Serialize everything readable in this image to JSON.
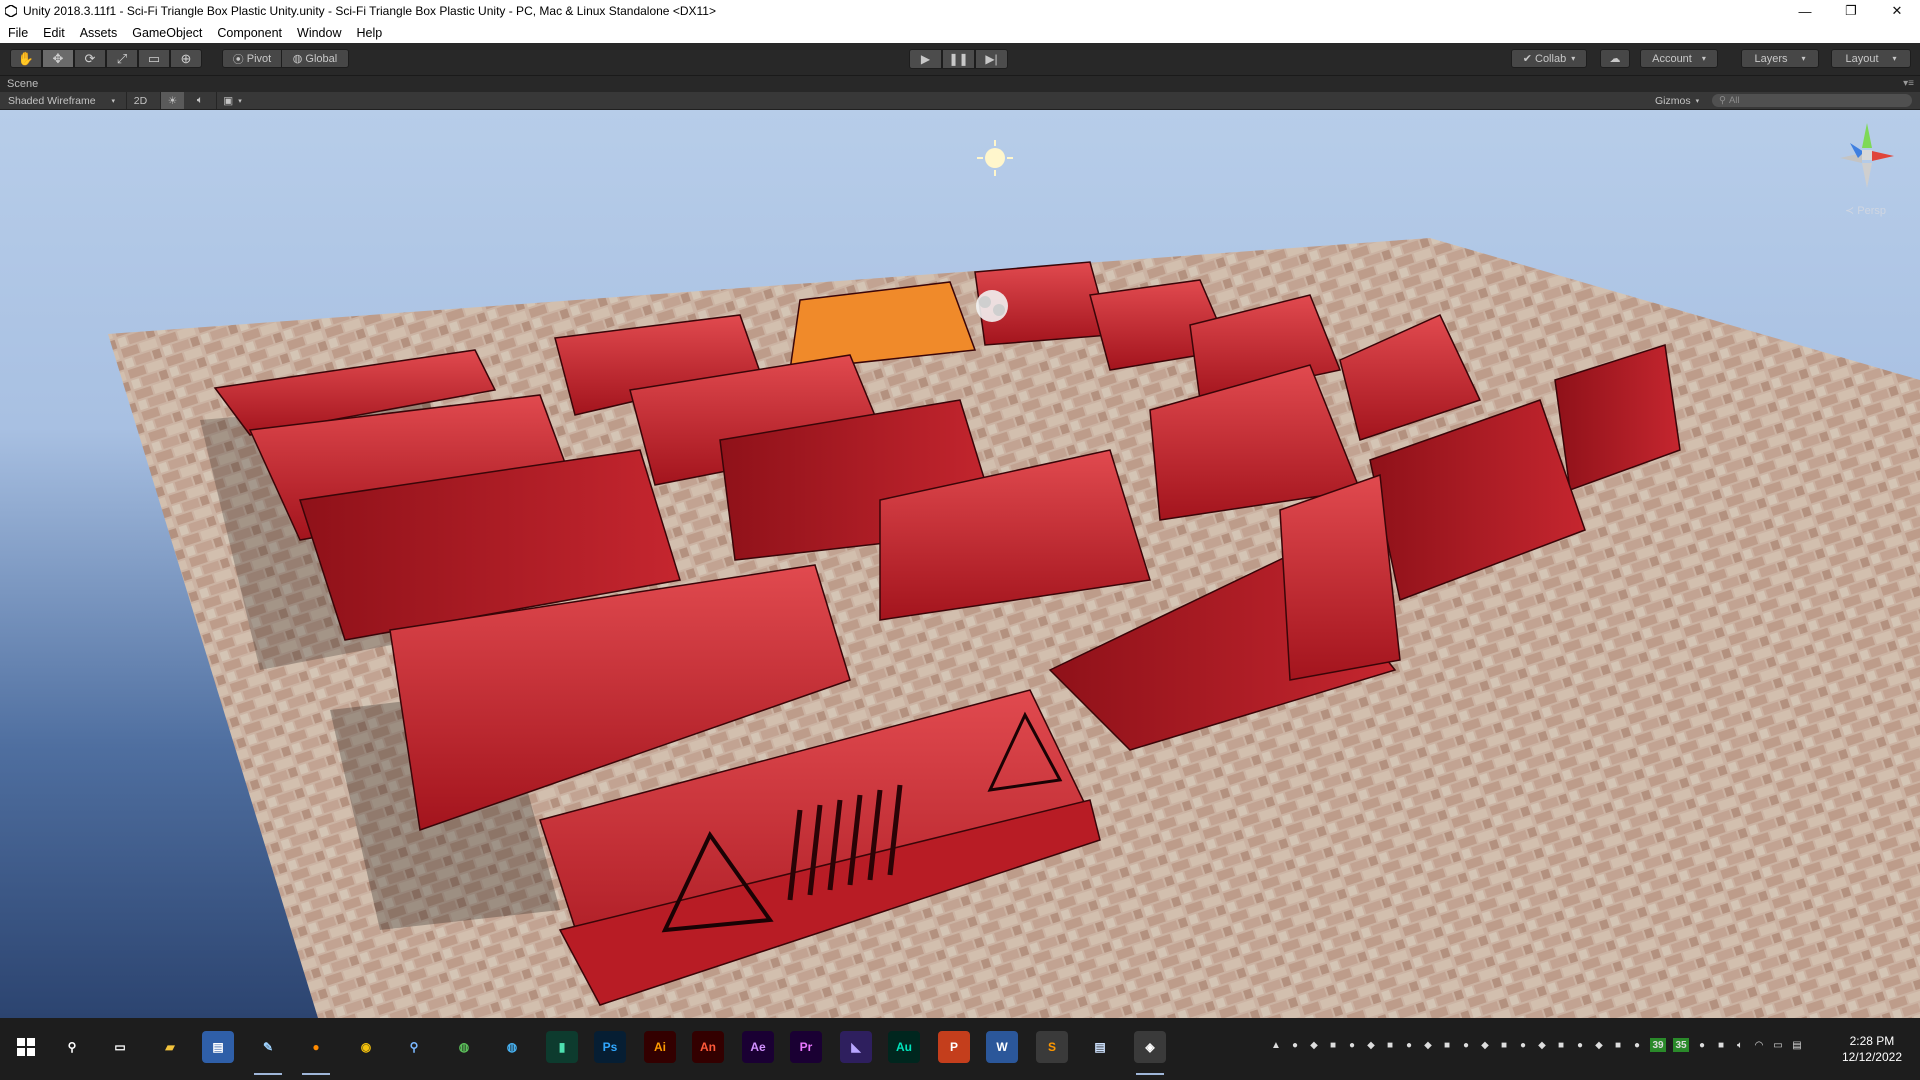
{
  "window": {
    "title": "Unity 2018.3.11f1 - Sci-Fi Triangle Box Plastic Unity.unity - Sci-Fi Triangle Box Plastic Unity - PC, Mac & Linux Standalone <DX11>",
    "minimize_glyph": "—",
    "restore_glyph": "❐",
    "close_glyph": "✕"
  },
  "menu": [
    "File",
    "Edit",
    "Assets",
    "GameObject",
    "Component",
    "Window",
    "Help"
  ],
  "toolbar": {
    "tools": [
      "hand-tool-icon",
      "move-tool-icon",
      "rotate-tool-icon",
      "scale-tool-icon",
      "rect-tool-icon",
      "transform-tool-icon"
    ],
    "pivot_label": "Pivot",
    "global_label": "Global",
    "play_glyph": "▶",
    "pause_glyph": "❚❚",
    "step_glyph": "▶|",
    "collab_label": "Collab",
    "account_label": "Account",
    "layers_label": "Layers",
    "layout_label": "Layout"
  },
  "scene": {
    "tab_label": "Scene",
    "shading_mode": "Shaded Wireframe",
    "mode_2d": "2D",
    "gizmos_label": "Gizmos",
    "search_placeholder": "All",
    "projection_label": "Persp"
  },
  "taskbar": {
    "apps": [
      "start",
      "search",
      "task-view",
      "file-explorer",
      "app-blue",
      "paint",
      "firefox",
      "chrome",
      "search-app",
      "globe",
      "globe-2",
      "dreamweaver",
      "photoshop",
      "illustrator",
      "animate",
      "after-effects",
      "premiere",
      "visual-studio",
      "audition",
      "powerpoint",
      "word",
      "sublime",
      "notepad",
      "unity"
    ],
    "app_labels": {
      "photoshop": "Ps",
      "illustrator": "Ai",
      "animate": "An",
      "after_effects": "Ae",
      "premiere": "Pr",
      "audition": "Au",
      "powerpoint": "P",
      "word": "W"
    },
    "tray_badges": [
      "39",
      "35"
    ],
    "time": "2:28 PM",
    "date": "12/12/2022"
  },
  "colors": {
    "accent_red": "#c0202a",
    "floor_tan": "#d6b9a4",
    "sky_blue": "#a9c4e6"
  }
}
